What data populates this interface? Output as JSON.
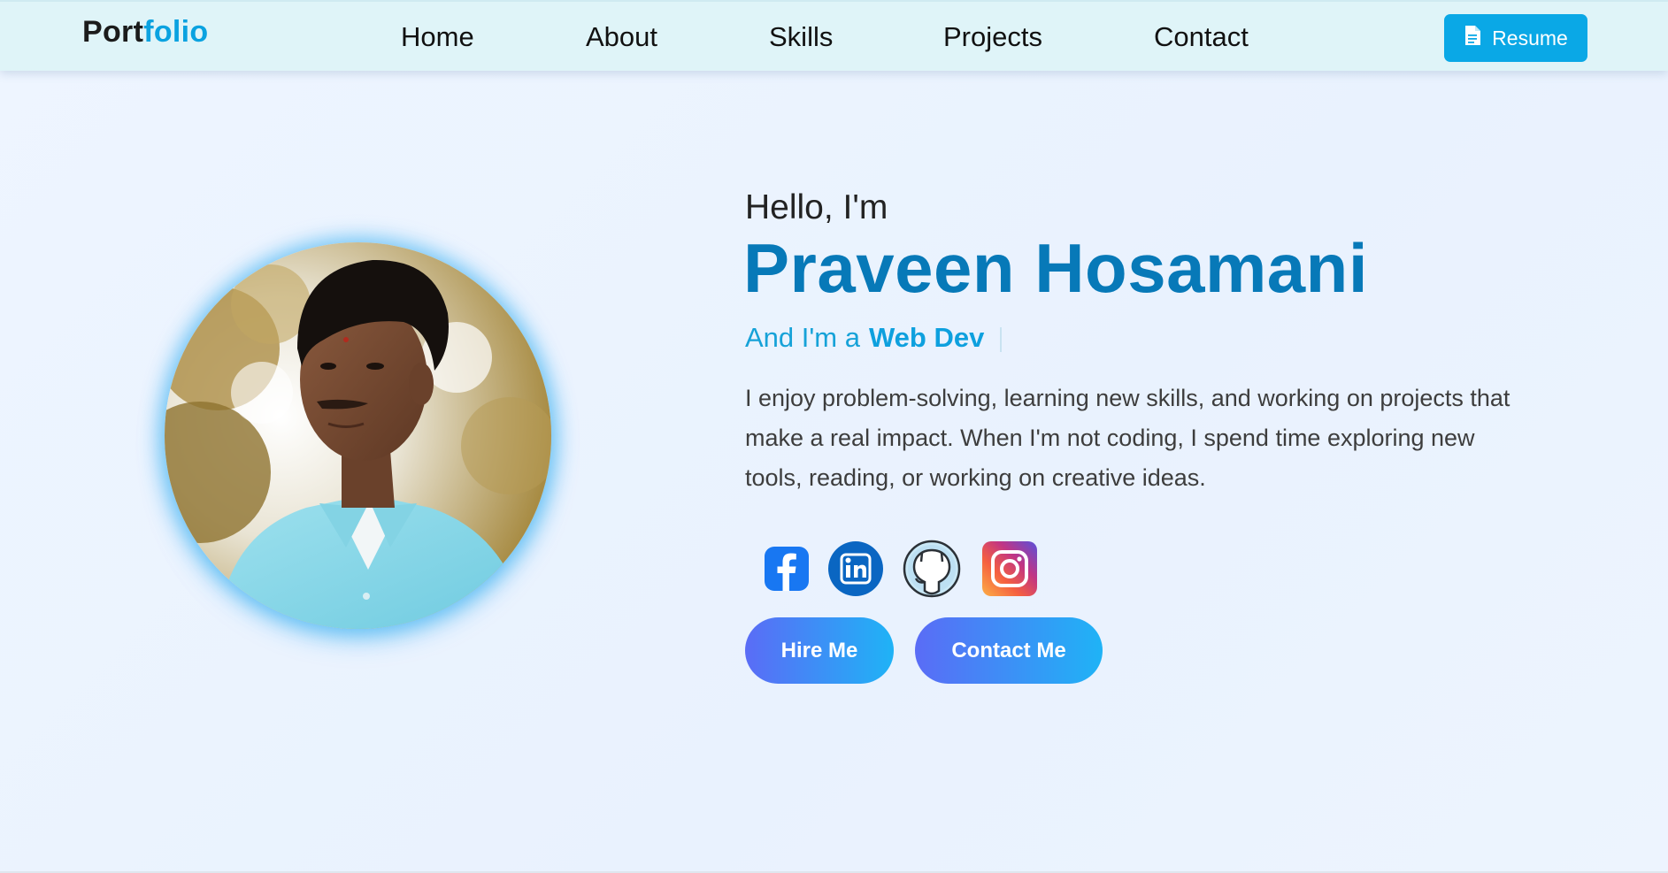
{
  "nav": {
    "logo_part1": "Port",
    "logo_part2": "folio",
    "links": [
      "Home",
      "About",
      "Skills",
      "Projects",
      "Contact"
    ],
    "resume_label": "Resume",
    "resume_icon": "document-icon"
  },
  "hero": {
    "greeting": "Hello, I'm",
    "name": "Praveen Hosamani",
    "role_prefix": "And I'm a",
    "role": "Web Dev",
    "bio": "I enjoy problem-solving, learning new skills, and working on projects that make a real impact. When I'm not coding, I spend time exploring new tools, reading, or working on creative ideas."
  },
  "socials": [
    "facebook-icon",
    "linkedin-icon",
    "github-icon",
    "instagram-icon"
  ],
  "buttons": {
    "hire": "Hire Me",
    "contact": "Contact Me"
  },
  "colors": {
    "accent": "#0aa8e6",
    "name": "#0779b8",
    "nav_bg": "#dff4f8",
    "button_gradient_start": "#5a6cf6",
    "button_gradient_end": "#1fb3f6"
  }
}
